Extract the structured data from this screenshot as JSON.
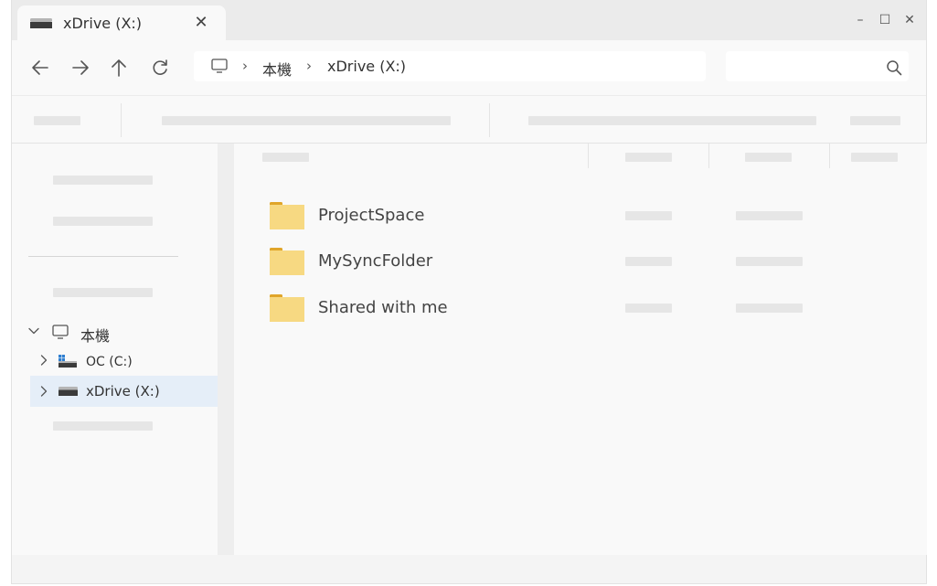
{
  "tab": {
    "title": "xDrive (X:)",
    "close_glyph": "✕"
  },
  "window_controls": {
    "minimize": "–",
    "maximize": "☐",
    "close": "✕"
  },
  "address": {
    "pc_icon": "computer-icon",
    "crumbs": [
      "本機",
      "xDrive (X:)"
    ],
    "separator": "›"
  },
  "search": {
    "placeholder": "",
    "icon": "search-icon"
  },
  "sidebar": {
    "tree": [
      {
        "label": "本機",
        "icon": "computer-icon",
        "expanded": true
      },
      {
        "label": "OC (C:)",
        "icon": "windows-drive-icon",
        "expanded": false
      },
      {
        "label": "xDrive (X:)",
        "icon": "drive-icon",
        "expanded": false,
        "selected": true
      }
    ]
  },
  "content": {
    "items": [
      {
        "name": "ProjectSpace",
        "icon": "folder-icon"
      },
      {
        "name": "MySyncFolder",
        "icon": "folder-icon"
      },
      {
        "name": "Shared with me",
        "icon": "folder-icon"
      }
    ]
  },
  "colors": {
    "folder": "#f7d982",
    "folder_tab": "#e0a52a",
    "selected_bg": "#e5eef8",
    "placeholder": "#e6e6e6"
  }
}
